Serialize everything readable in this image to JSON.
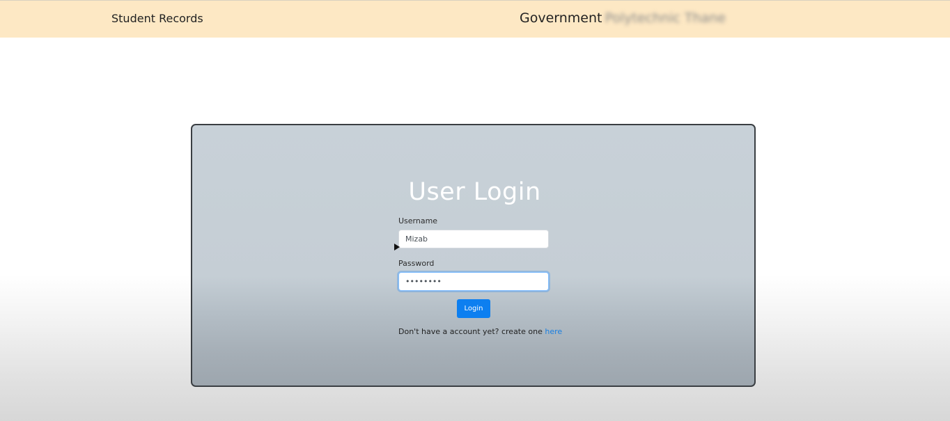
{
  "navbar": {
    "brand": "Student Records",
    "gov_title_visible": "Government",
    "gov_title_blurred": "Polytechnic Thane"
  },
  "login": {
    "title": "User Login",
    "username_label": "Username",
    "username_value": "Mizab",
    "password_label": "Password",
    "password_value": "••••••••",
    "button_label": "Login",
    "signup_prompt": "Don't have a account yet? create one",
    "signup_link": "here"
  },
  "colors": {
    "navbar_bg": "#fde8c4",
    "button_bg": "#0d7ff0",
    "link": "#1a7fe0"
  },
  "icons": {
    "cursor": "mouse-cursor-icon"
  }
}
